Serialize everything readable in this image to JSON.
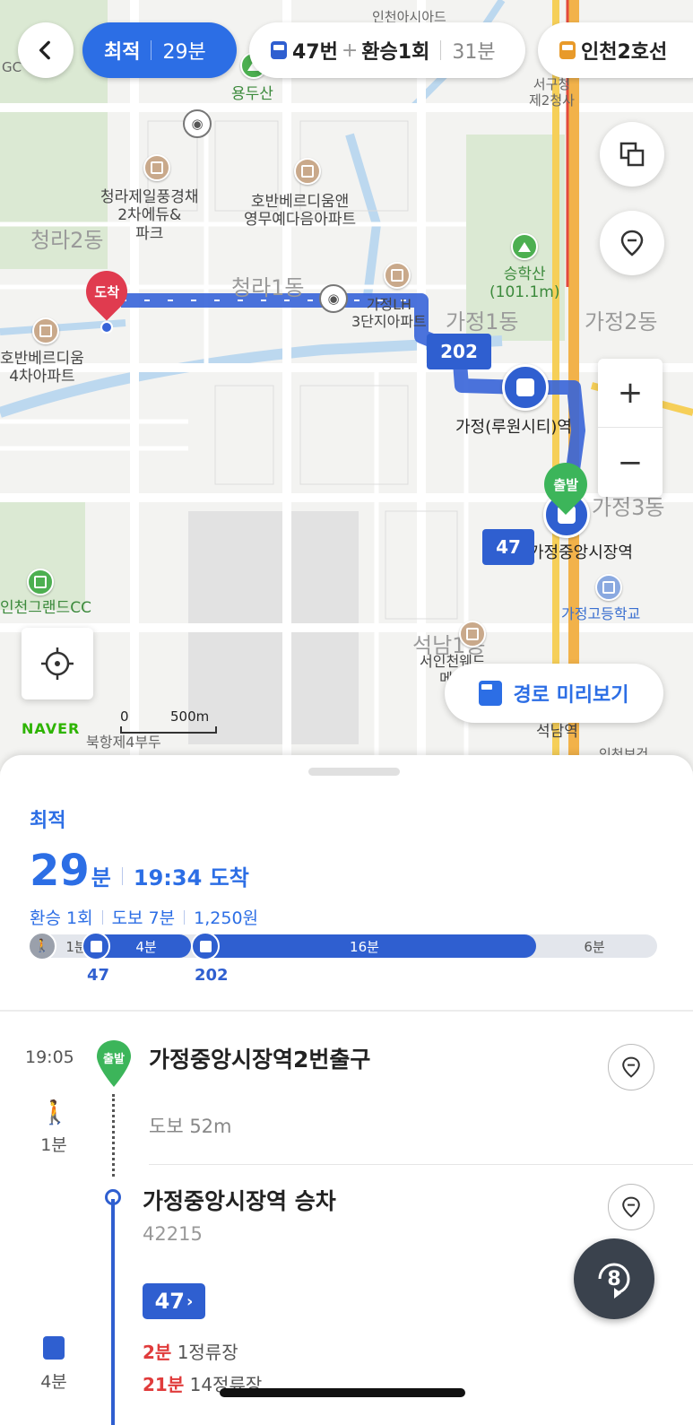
{
  "top": {
    "tabs": [
      {
        "label": "최적",
        "time": "29분"
      },
      {
        "route": "47번",
        "plus": "+",
        "transfer": "환승1회",
        "time": "31분"
      },
      {
        "label": "인천2호선"
      }
    ]
  },
  "map": {
    "labels": {
      "yongdusan": "용두산",
      "cheongra_apt": "청라제일풍경채\n2차에듀&\n파크",
      "hoban_apt": "호반베르디움앤\n영무예다음아파트",
      "cheongra2": "청라2동",
      "cheongra1": "청라1동",
      "gajeong_naeapt": "가정LH\n3단지아파트",
      "gajeong1": "가정1동",
      "gajeong2": "가정2동",
      "gajeong3": "가정3동",
      "hoban4": "호반베르디움\n4차아파트",
      "seunghaksan": "승학산\n(101.1m)",
      "seogu_office": "서구청\n제2청사",
      "station_gajeong": "가정(루원시티)역",
      "station_market": "가정중앙시장역",
      "incheon_cc": "인천그랜드CC",
      "gajeong_high": "가정고등학교",
      "seoknam": "석남1동",
      "seoknam_station": "석남역",
      "bukhang": "북항제4부두",
      "partial_top": "인천아시아드",
      "partial_gc": "GC",
      "partial_seoinch": "서인천웨드\n메르",
      "partial_incheon_bo": "인천보건"
    },
    "arrive_pin": "도착",
    "start_pin": "출발",
    "route_tags": {
      "first": "202",
      "second": "47"
    },
    "preview_button": "경로 미리보기",
    "brand": "NAVER",
    "scale": {
      "zero": "0",
      "dist": "500m"
    },
    "zoom": {
      "plus": "+",
      "minus": "−"
    }
  },
  "summary": {
    "option": "최적",
    "minutes": "29",
    "minutes_unit": "분",
    "arrive": "19:34 도착",
    "transfer": "환승 1회",
    "walk": "도보 7분",
    "fare": "1,250원",
    "segments": [
      {
        "kind": "walk",
        "label": "1분"
      },
      {
        "kind": "bus",
        "label": "4분",
        "route": "47"
      },
      {
        "kind": "bus",
        "label": "16분",
        "route": "202"
      },
      {
        "kind": "walk",
        "label": "6분"
      }
    ]
  },
  "steps": {
    "start_time": "19:05",
    "start_pin_label": "출발",
    "start_title": "가정중앙시장역2번출구",
    "walk_minutes": "1분",
    "walk_desc": "도보 52m",
    "board_title": "가정중앙시장역 승차",
    "board_stop_id": "42215",
    "bus_route": "47",
    "bus_minutes": "4분",
    "arrivals": [
      {
        "min": "2분",
        "stops": "1정류장"
      },
      {
        "min": "21분",
        "stops": "14정류장"
      }
    ],
    "fab_count": "8"
  },
  "colors": {
    "accent": "#2c6ee5",
    "bus": "#2f5fd0",
    "start": "#3cb55a",
    "arrive": "#e03b4f"
  }
}
